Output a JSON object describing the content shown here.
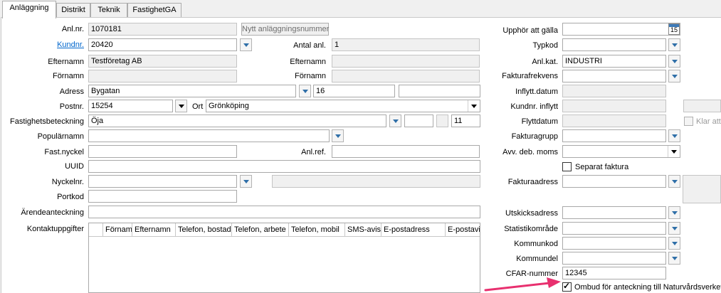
{
  "tabs": [
    "Anläggning",
    "Distrikt",
    "Teknik",
    "FastighetGA"
  ],
  "left": {
    "anlnr": {
      "label": "Anl.nr.",
      "value": "1070181"
    },
    "new_number_button": "Nytt anläggningsnummer",
    "kundnr": {
      "label": "Kundnr.",
      "value": "20420"
    },
    "antal_anl": {
      "label": "Antal anl.",
      "value": "1"
    },
    "efternamn": {
      "label": "Efternamn",
      "value": "Testföretag AB"
    },
    "efternamn2": {
      "label": "Efternamn",
      "value": ""
    },
    "fornamn": {
      "label": "Förnamn",
      "value": ""
    },
    "fornamn2": {
      "label": "Förnamn",
      "value": ""
    },
    "adress": {
      "label": "Adress",
      "street": "Bygatan",
      "number": "16",
      "extra": ""
    },
    "postnr": {
      "label": "Postnr.",
      "value": "15254"
    },
    "ort": {
      "label": "Ort",
      "value": "Grönköping"
    },
    "fastighet": {
      "label": "Fastighetsbeteckning",
      "value": "Öja",
      "part2": "",
      "part3": "",
      "part4": "11"
    },
    "popularnamn": {
      "label": "Populärnamn",
      "value": ""
    },
    "fastnyckel": {
      "label": "Fast.nyckel",
      "value": ""
    },
    "anlref": {
      "label": "Anl.ref.",
      "value": ""
    },
    "uuid": {
      "label": "UUID",
      "value": ""
    },
    "nyckelnr": {
      "label": "Nyckelnr.",
      "value": "",
      "extra": ""
    },
    "portkod": {
      "label": "Portkod",
      "value": ""
    },
    "arendeanteckning": {
      "label": "Ärendeanteckning",
      "value": ""
    },
    "kontaktuppgifter": {
      "label": "Kontaktuppgifter",
      "columns": [
        "Förnamn",
        "Efternamn",
        "Telefon, bostad",
        "Telefon, arbete",
        "Telefon, mobil",
        "SMS-avisering",
        "E-postadress",
        "E-postavisering"
      ]
    }
  },
  "right": {
    "upphor": {
      "label": "Upphör att gälla",
      "value": ""
    },
    "calendar_day": "15",
    "typkod": {
      "label": "Typkod",
      "value": ""
    },
    "anlkat": {
      "label": "Anl.kat.",
      "value": "INDUSTRI"
    },
    "fakturafrekvens": {
      "label": "Fakturafrekvens",
      "value": ""
    },
    "inflyttdatum": {
      "label": "Inflytt.datum",
      "value": ""
    },
    "kundnr_inflytt": {
      "label": "Kundnr. inflytt",
      "value": ""
    },
    "flyttdatum": {
      "label": "Flyttdatum",
      "value": ""
    },
    "klar_att": "Klar att s",
    "fakturagrupp": {
      "label": "Fakturagrupp",
      "value": ""
    },
    "avv_deb_moms": {
      "label": "Avv. deb. moms",
      "value": ""
    },
    "separat_faktura": "Separat faktura",
    "fakturaadress": {
      "label": "Fakturaadress",
      "value": ""
    },
    "utskicksadress": {
      "label": "Utskicksadress",
      "value": ""
    },
    "statistikomrade": {
      "label": "Statistikområde",
      "value": ""
    },
    "kommunkod": {
      "label": "Kommunkod",
      "value": ""
    },
    "kommundel": {
      "label": "Kommundel",
      "value": ""
    },
    "cfar": {
      "label": "CFAR-nummer",
      "value": "12345"
    },
    "ombud": {
      "label": "Ombud för anteckning till Naturvårdsverket",
      "checked": true
    }
  },
  "colors": {
    "link": "#0066cc",
    "arrow": "#e8306f",
    "dropdown_arrow": "#2f6fa8"
  }
}
